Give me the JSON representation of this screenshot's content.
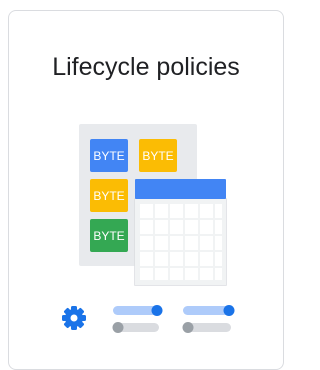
{
  "card": {
    "title": "Lifecycle policies"
  },
  "illustration": {
    "tiles": [
      {
        "label": "BYTE",
        "color": "#4285f4"
      },
      {
        "label": "BYTE",
        "color": "#fbbc04"
      },
      {
        "label": "BYTE",
        "color": "#fbbc04"
      },
      {
        "label": "BYTE",
        "color": "#34a853"
      }
    ],
    "colors": {
      "panel": "#e8eaed",
      "table_header": "#4285f4",
      "table_grid": "#dadce0",
      "gear": "#1a73e8",
      "toggle_on": "#1a73e8",
      "toggle_track_on": "#aecbfa",
      "toggle_off": "#9aa0a6",
      "toggle_track_off": "#dadce0"
    }
  }
}
